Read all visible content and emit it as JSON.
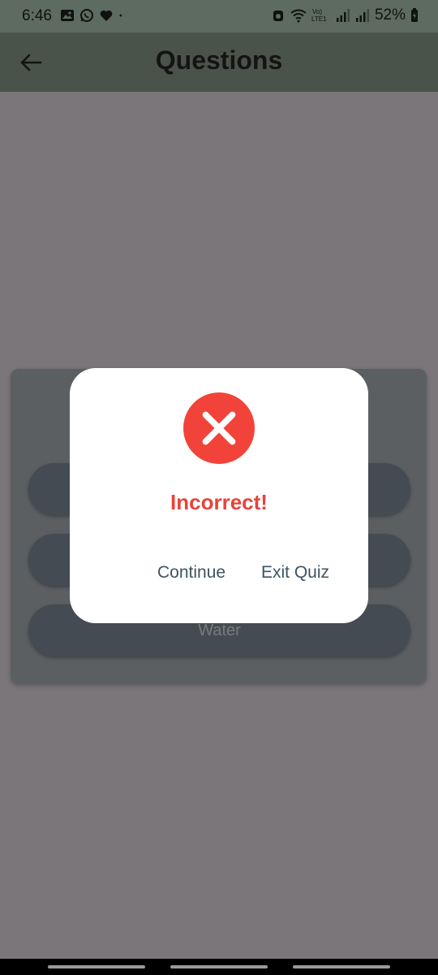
{
  "status_bar": {
    "time": "6:46",
    "battery": "52%",
    "left_icons": [
      "gallery-icon",
      "whatsapp-icon",
      "heart-icon",
      "dot-icon"
    ],
    "right_icons": [
      "alarm-icon",
      "wifi-icon",
      "volte-icon",
      "signal-icon",
      "signal-icon",
      "battery-icon"
    ],
    "volte_label_top": "Vo)",
    "volte_label_bottom": "LTE1"
  },
  "app_bar": {
    "title": "Questions",
    "back_icon": "arrow-left-icon"
  },
  "quiz": {
    "options": [
      "",
      "",
      "Water"
    ]
  },
  "dialog": {
    "icon": "close-circle-icon",
    "icon_color": "#f2433a",
    "message": "Incorrect!",
    "message_color": "#e8433a",
    "continue_label": "Continue",
    "exit_label": "Exit Quiz"
  }
}
